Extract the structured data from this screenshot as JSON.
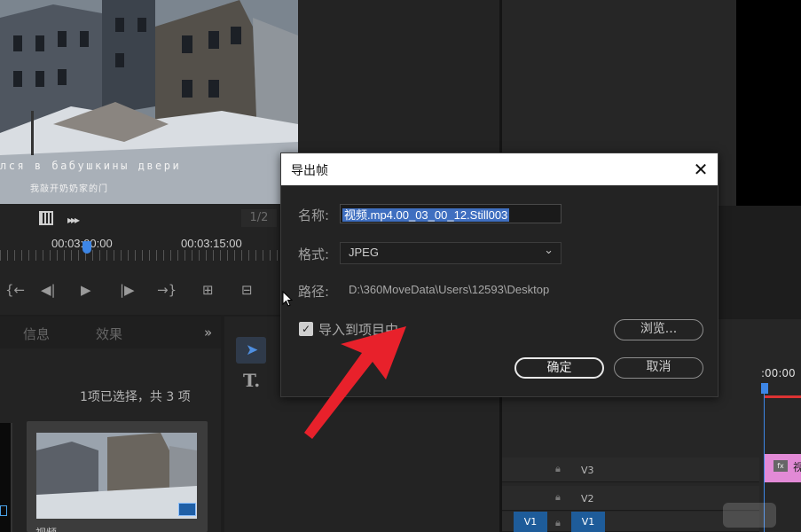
{
  "source_monitor": {
    "subtitle_ru": "лся в бабушкины двери",
    "subtitle_cn": "我敲开奶奶家的门",
    "ratio": "1/2",
    "timecode_current": "00:03:00:00",
    "timecode_next": "00:03:15:00"
  },
  "project_panel": {
    "tabs": [
      "信息",
      "效果"
    ],
    "overflow": "»",
    "selection_status": "1项已选择，共 3 项",
    "clip_name": "视频"
  },
  "timeline": {
    "timecode": ":00:00",
    "tracks": [
      {
        "label": "V3"
      },
      {
        "label": "V2"
      },
      {
        "label": "V1",
        "source_label": "V1"
      }
    ],
    "fx_badge": "fx",
    "clip_label": "视"
  },
  "dialog": {
    "title": "导出帧",
    "close": "✕",
    "name_label": "名称:",
    "name_value": "视频.mp4.00_03_00_12.Still003",
    "format_label": "格式:",
    "format_value": "JPEG",
    "path_label": "路径:",
    "path_value": "D:\\360MoveData\\Users\\12593\\Desktop",
    "import_label": "导入到项目中",
    "import_checked": true,
    "browse_label": "浏览...",
    "ok_label": "确定",
    "cancel_label": "取消"
  },
  "colors": {
    "accent_blue": "#3d86e6",
    "selection_blue": "#3f6fc0",
    "arrow_red": "#e8212b",
    "clip_pink": "#e28ad6"
  }
}
